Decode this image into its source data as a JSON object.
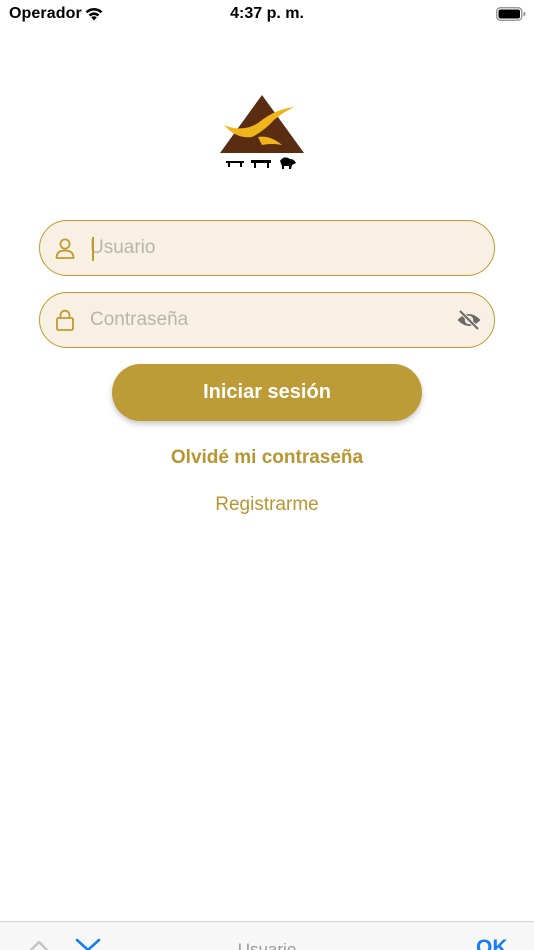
{
  "status_bar": {
    "carrier": "Operador",
    "time": "4:37 p. m."
  },
  "login": {
    "username_placeholder": "Usuario",
    "password_placeholder": "Contraseña",
    "submit_label": "Iniciar sesión",
    "forgot_label": "Olvidé mi contraseña",
    "register_label": "Registrarme"
  },
  "keyboard_toolbar": {
    "field_label": "Usuario",
    "done_label": "OK"
  },
  "colors": {
    "accent": "#bd9b36",
    "field_fill": "#f8f1e3",
    "field_border": "#c0992f",
    "logo_brown": "#5a2d13",
    "logo_yellow": "#f0b51b",
    "toolbar_blue": "#1a7cf2"
  },
  "icons": [
    "wifi-icon",
    "battery-icon",
    "user-icon",
    "lock-icon",
    "eye-off-icon",
    "chevron-up-icon",
    "chevron-down-icon"
  ]
}
